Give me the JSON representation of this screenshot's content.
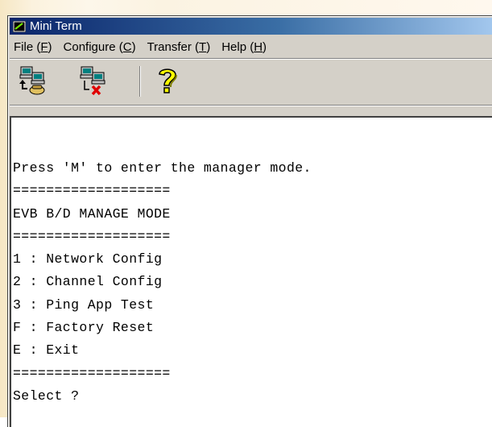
{
  "window": {
    "title": "Mini Term"
  },
  "menu": {
    "items": [
      {
        "label": "File (F)"
      },
      {
        "label": "Configure (C)"
      },
      {
        "label": "Transfer (T)"
      },
      {
        "label": "Help (H)"
      }
    ]
  },
  "toolbar": {
    "buttons": [
      {
        "icon": "connect-icon"
      },
      {
        "icon": "disconnect-icon"
      },
      {
        "icon": "help-icon"
      }
    ]
  },
  "terminal": {
    "lines": [
      "Press 'M' to enter the manager mode.",
      "===================",
      "EVB B/D MANAGE MODE",
      "===================",
      "1 : Network Config",
      "2 : Channel Config",
      "3 : Ping App Test",
      "F : Factory Reset",
      "E : Exit",
      "===================",
      "Select ?"
    ]
  },
  "colors": {
    "titlebar_start": "#0a246a",
    "titlebar_end": "#a6caf0",
    "window_face": "#d4d0c8",
    "terminal_bg": "#ffffff",
    "terminal_text": "#000000",
    "desktop_bg": "#fbf2de"
  }
}
